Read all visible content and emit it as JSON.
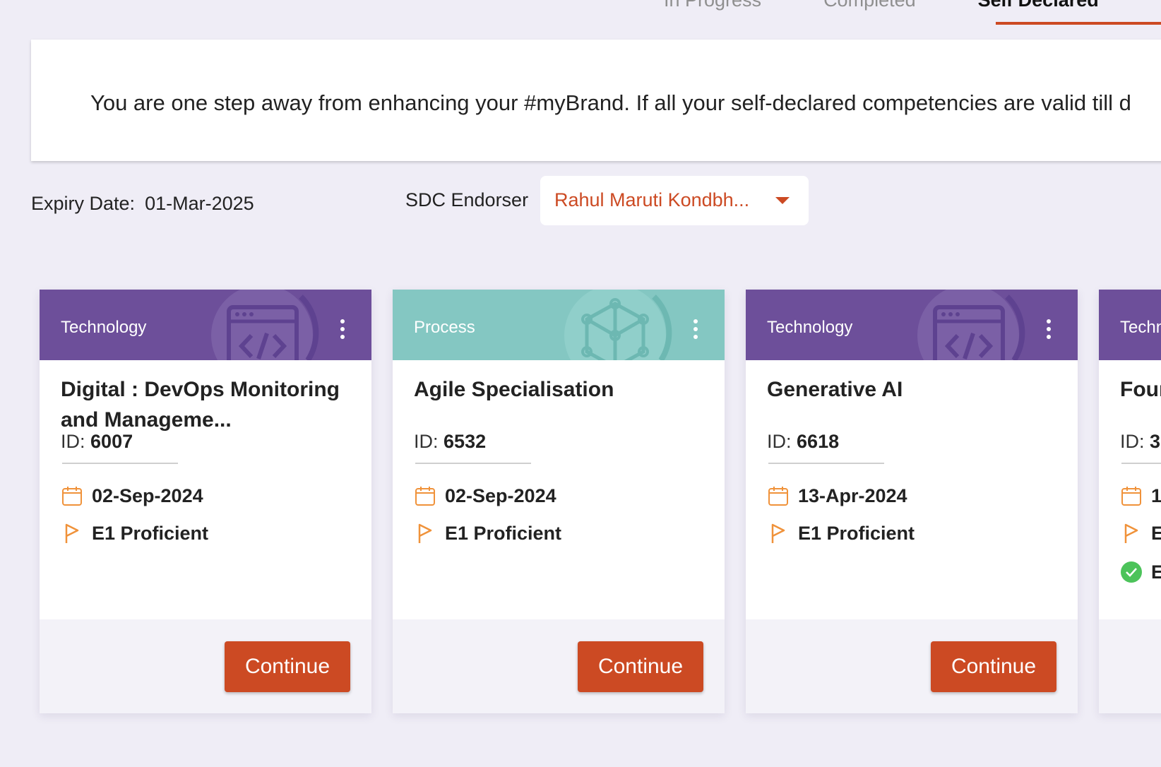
{
  "tabs": [
    {
      "label": "In Progress"
    },
    {
      "label": "Completed"
    },
    {
      "label": "Self Declared"
    }
  ],
  "banner": {
    "text": "You are one step away from enhancing your #myBrand. If all your self-declared competencies are valid till d"
  },
  "expiry": {
    "label": "Expiry Date:",
    "value": "01-Mar-2025"
  },
  "sdc_endorser": {
    "label": "SDC Endorser",
    "value": "Rahul Maruti Kondbh..."
  },
  "cards": [
    {
      "category": "Technology",
      "title": "Digital : DevOps Monitoring and Manageme...",
      "id_label": "ID:",
      "id": "6007",
      "date": "02-Sep-2024",
      "level": "E1 Proficient",
      "button": "Continue"
    },
    {
      "category": "Process",
      "title": "Agile Specialisation",
      "id_label": "ID:",
      "id": "6532",
      "date": "02-Sep-2024",
      "level": "E1 Proficient",
      "button": "Continue"
    },
    {
      "category": "Technology",
      "title": "Generative AI",
      "id_label": "ID:",
      "id": "6618",
      "date": "13-Apr-2024",
      "level": "E1 Proficient",
      "button": "Continue"
    },
    {
      "category": "Techn",
      "title": "Four",
      "id_label": "ID:",
      "id": "3",
      "date": "1",
      "level": "E",
      "status": "E"
    }
  ],
  "colors": {
    "accent": "#cc4a23",
    "technology_header": "#6d4f9a",
    "process_header": "#84c7c2",
    "page_bg": "#efedf6",
    "icon_orange": "#f0923a",
    "check_green": "#4cc35a"
  },
  "icons": {
    "date": "calendar-icon",
    "level": "flag-icon",
    "status": "check-circle-icon",
    "menu": "more-vertical-icon",
    "technology_art": "code-window-icon",
    "process_art": "cube-network-icon",
    "dropdown": "caret-down-icon"
  }
}
